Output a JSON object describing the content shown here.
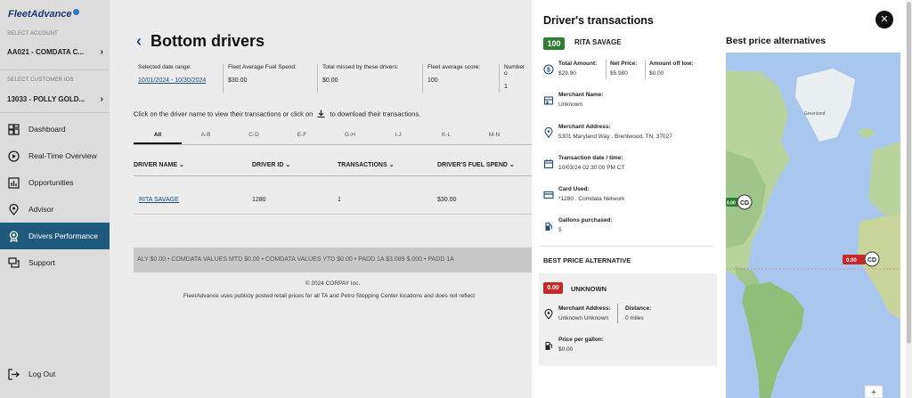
{
  "sidebar": {
    "logo": "FleetAdvance",
    "account_label": "SELECT ACCOUNT",
    "account_value": "AA021 - COMDATA C...",
    "customer_label": "SELECT CUSTOMER IDS",
    "customer_value": "13033 - POLLY GOLD...",
    "nav": [
      {
        "label": "Dashboard",
        "icon": "dashboard-icon"
      },
      {
        "label": "Real-Time Overview",
        "icon": "play-circle-icon"
      },
      {
        "label": "Opportunities",
        "icon": "chart-icon"
      },
      {
        "label": "Advisor",
        "icon": "location-pin-icon"
      },
      {
        "label": "Drivers Performance",
        "icon": "driver-badge-icon"
      },
      {
        "label": "Support",
        "icon": "chat-icon"
      }
    ],
    "logout": "Log Out"
  },
  "main": {
    "title": "Bottom drivers",
    "stats": [
      {
        "label": "Selected date range:",
        "value": "10/01/2024 - 10/30/2024"
      },
      {
        "label": "Fleet Average Fuel Spend:",
        "value": "$30.00"
      },
      {
        "label": "Total missed by these drivers:",
        "value": "$0.00"
      },
      {
        "label": "Fleet average score:",
        "value": "100"
      },
      {
        "label": "Number o",
        "value": "1"
      }
    ],
    "instruction_prefix": "Click on the driver name to view their transactions or click on",
    "instruction_suffix": "to download their transactions.",
    "tabs": [
      "All",
      "A-B",
      "C-D",
      "E-F",
      "G-H",
      "I-J",
      "K-L",
      "M-N"
    ],
    "columns": [
      "DRIVER NAME",
      "DRIVER ID",
      "TRANSACTIONS",
      "DRIVER'S FUEL SPEND"
    ],
    "rows": [
      {
        "name": "RITA SAVAGE",
        "id": "1280",
        "transactions": "1",
        "spend": "$30.00"
      }
    ],
    "ticker": "ALY $0.00 • COMDATA VALUES MTD $0.00 • COMDATA VALUES YTD $0.00 • PADD 1A $3.089 $.000 • PADD 1A",
    "copyright": "© 2024 CORPAY Inc.",
    "disclaimer": "FleetAdvance uses publicly posted retail prices for all TA and Petro Stopping Center locations and does not reflect"
  },
  "panel": {
    "title": "Driver's transactions",
    "score": "100",
    "driver": "RITA SAVAGE",
    "total_amount_label": "Total Amount:",
    "total_amount": "$29.90",
    "net_price_label": "Net Price:",
    "net_price": "$5.980",
    "amount_off_label": "Amount off low:",
    "amount_off": "$0.00",
    "merchant_name_label": "Merchant Name:",
    "merchant_name": "Unknown",
    "merchant_address_label": "Merchant Address:",
    "merchant_address": "5301 Maryland Way , Brentwood, TN, 37027",
    "txn_time_label": "Transaction date / time:",
    "txn_time": "10/03/24 02:30:00 PM CT",
    "card_label": "Card Used:",
    "card": "*1280 . Comdata Network",
    "gallons_label": "Gallons purchased:",
    "gallons": "5",
    "bpa_heading": "BEST PRICE ALTERNATIVE",
    "bpa_price": "0.00",
    "bpa_name": "UNKNOWN",
    "bpa_address_label": "Merchant Address:",
    "bpa_address": "Unknown Unknown",
    "bpa_distance_label": "Distance:",
    "bpa_distance": "0 miles",
    "bpa_ppg_label": "Price per gallon:",
    "bpa_ppg": "$0.00",
    "map_title": "Best price alternatives",
    "map_labels": {
      "greenland": "Greenland",
      "marker_left": "0.00",
      "marker_right": "0.00",
      "zoom_in": "+"
    }
  },
  "colors": {
    "score_green": "#2e7d32",
    "price_red": "#c62828",
    "nav_active": "#1f5a7c",
    "map_ocean": "#a9c7ee",
    "map_land": "#9fc58a"
  }
}
